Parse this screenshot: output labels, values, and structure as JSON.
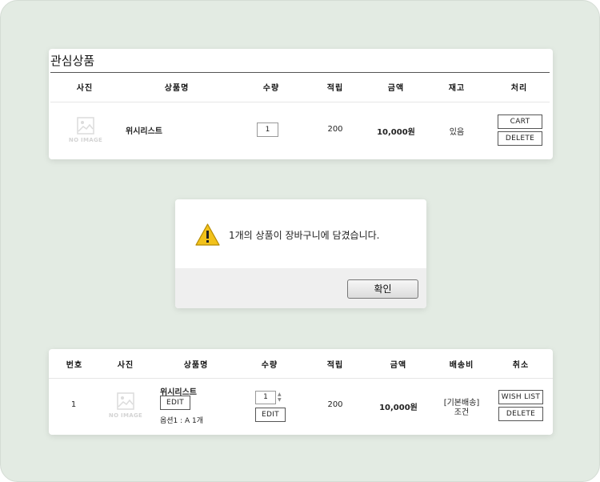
{
  "wishlist": {
    "title": "관심상품",
    "headers": [
      "사진",
      "상품명",
      "수량",
      "적립",
      "금액",
      "재고",
      "처리"
    ],
    "row": {
      "image_placeholder": "NO IMAGE",
      "name": "위시리스트",
      "quantity": "1",
      "points": "200",
      "price": "10,000원",
      "stock": "있음",
      "cart_label": "CART",
      "delete_label": "DELETE"
    }
  },
  "dialog": {
    "message": "1개의 상품이 장바구니에 담겼습니다.",
    "ok_label": "확인"
  },
  "cart": {
    "headers": [
      "번호",
      "사진",
      "상품명",
      "수량",
      "적립",
      "금액",
      "배송비",
      "취소"
    ],
    "row": {
      "number": "1",
      "image_placeholder": "NO IMAGE",
      "name": "위시리스트",
      "edit_label": "EDIT",
      "option": "옵션1 : A 1개",
      "quantity": "1",
      "qty_edit_label": "EDIT",
      "points": "200",
      "price": "10,000원",
      "shipping_line1": "[기본배송]",
      "shipping_line2": "조건",
      "wishlist_label": "WISH LIST",
      "delete_label": "DELETE"
    }
  },
  "colors": {
    "background": "#e3ebe3",
    "warning": "#f2c21b"
  }
}
